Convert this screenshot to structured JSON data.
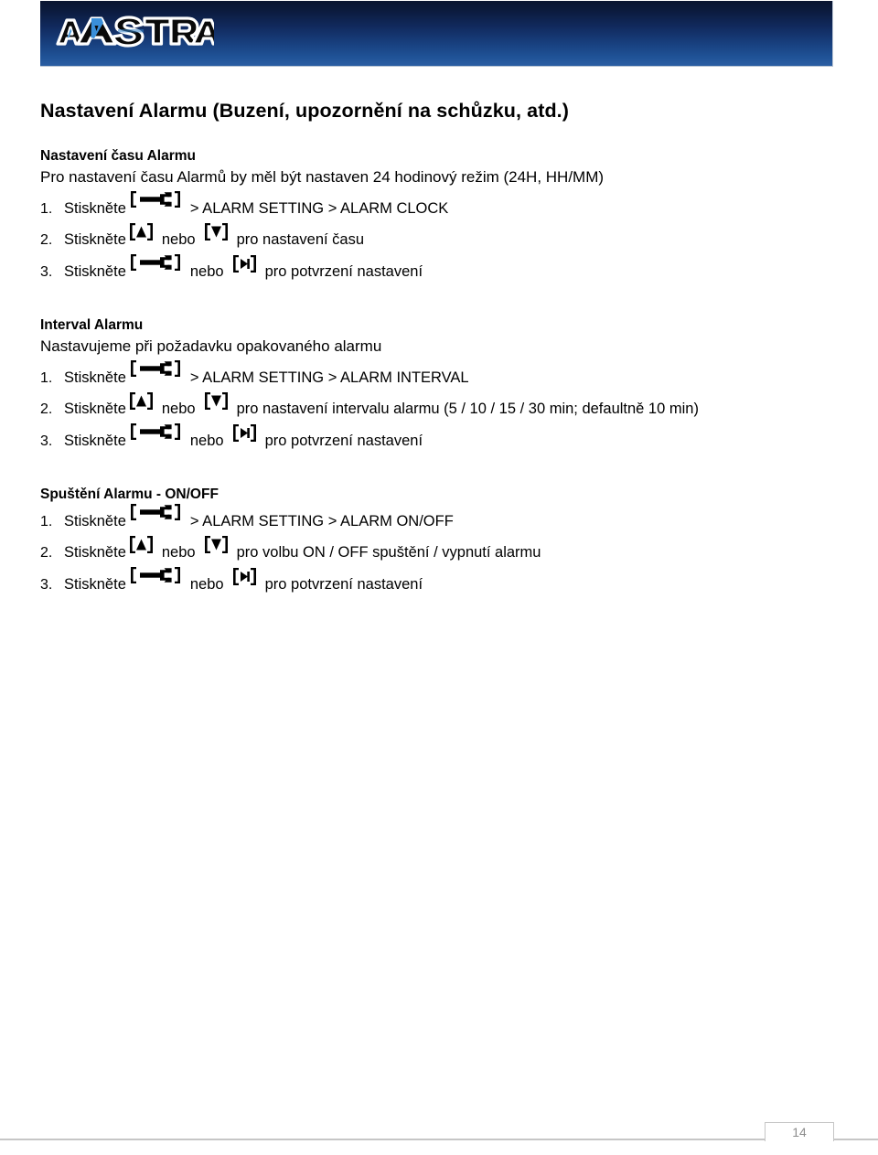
{
  "header": {
    "logo_text": "AASTRA",
    "logo_alt": "aastra-logo"
  },
  "document": {
    "title": "Nastavení Alarmu (Buzení, upozornění na schůzku, atd.)"
  },
  "icons": {
    "menu_key": "menu-key-icon",
    "up_key": "up-arrow-key-icon",
    "down_key": "down-arrow-key-icon",
    "right_key": "right-arrow-key-icon"
  },
  "sections": [
    {
      "heading": "Nastavení času Alarmu",
      "subtitle": "Pro nastavení času Alarmů by měl být nastaven 24 hodinový režim (24H, HH/MM)",
      "steps": [
        {
          "number": "1.",
          "lead": "Stiskněte",
          "icon1": "menu",
          "mid": "",
          "icon2": null,
          "tail": "> ALARM SETTING > ALARM CLOCK"
        },
        {
          "number": "2.",
          "lead": "Stiskněte",
          "icon1": "up",
          "mid": "nebo",
          "icon2": "down",
          "tail": "pro nastavení času"
        },
        {
          "number": "3.",
          "lead": "Stiskněte",
          "icon1": "menu",
          "mid": "nebo",
          "icon2": "right",
          "tail": "pro potvrzení nastavení"
        }
      ]
    },
    {
      "heading": "Interval Alarmu",
      "subtitle": "Nastavujeme při požadavku opakovaného alarmu",
      "steps": [
        {
          "number": "1.",
          "lead": "Stiskněte",
          "icon1": "menu",
          "mid": "",
          "icon2": null,
          "tail": "> ALARM SETTING > ALARM INTERVAL"
        },
        {
          "number": "2.",
          "lead": "Stiskněte",
          "icon1": "up",
          "mid": "nebo",
          "icon2": "down",
          "tail": "pro nastavení intervalu alarmu (5 / 10 / 15 / 30 min; defaultně 10 min)"
        },
        {
          "number": "3.",
          "lead": "Stiskněte",
          "icon1": "menu",
          "mid": "nebo",
          "icon2": "right",
          "tail": "pro potvrzení nastavení"
        }
      ]
    },
    {
      "heading": "Spuštění Alarmu - ON/OFF",
      "subtitle": "",
      "steps": [
        {
          "number": "1.",
          "lead": "Stiskněte",
          "icon1": "menu",
          "mid": "",
          "icon2": null,
          "tail": "> ALARM SETTING > ALARM ON/OFF"
        },
        {
          "number": "2.",
          "lead": "Stiskněte",
          "icon1": "up",
          "mid": "nebo",
          "icon2": "down",
          "tail": "pro volbu ON / OFF spuštění / vypnutí alarmu"
        },
        {
          "number": "3.",
          "lead": "Stiskněte",
          "icon1": "menu",
          "mid": "nebo",
          "icon2": "right",
          "tail": "pro potvrzení nastavení"
        }
      ]
    }
  ],
  "footer": {
    "page_number": "14"
  },
  "colors": {
    "banner_top": "#0a1530",
    "banner_bottom": "#2b5ea3",
    "logo_blue": "#3a8fd9",
    "footer_rule": "#c6c6c6",
    "page_number": "#8c8c8c"
  }
}
